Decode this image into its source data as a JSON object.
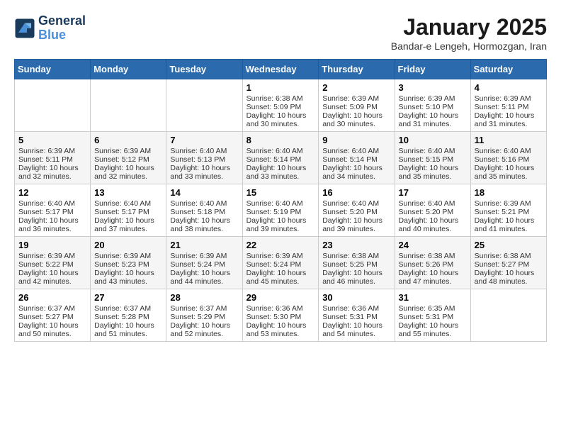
{
  "logo": {
    "line1": "General",
    "line2": "Blue"
  },
  "title": "January 2025",
  "subtitle": "Bandar-e Lengeh, Hormozgan, Iran",
  "days_of_week": [
    "Sunday",
    "Monday",
    "Tuesday",
    "Wednesday",
    "Thursday",
    "Friday",
    "Saturday"
  ],
  "weeks": [
    [
      {
        "day": "",
        "sunrise": "",
        "sunset": "",
        "daylight": ""
      },
      {
        "day": "",
        "sunrise": "",
        "sunset": "",
        "daylight": ""
      },
      {
        "day": "",
        "sunrise": "",
        "sunset": "",
        "daylight": ""
      },
      {
        "day": "1",
        "sunrise": "Sunrise: 6:38 AM",
        "sunset": "Sunset: 5:09 PM",
        "daylight": "Daylight: 10 hours and 30 minutes."
      },
      {
        "day": "2",
        "sunrise": "Sunrise: 6:39 AM",
        "sunset": "Sunset: 5:09 PM",
        "daylight": "Daylight: 10 hours and 30 minutes."
      },
      {
        "day": "3",
        "sunrise": "Sunrise: 6:39 AM",
        "sunset": "Sunset: 5:10 PM",
        "daylight": "Daylight: 10 hours and 31 minutes."
      },
      {
        "day": "4",
        "sunrise": "Sunrise: 6:39 AM",
        "sunset": "Sunset: 5:11 PM",
        "daylight": "Daylight: 10 hours and 31 minutes."
      }
    ],
    [
      {
        "day": "5",
        "sunrise": "Sunrise: 6:39 AM",
        "sunset": "Sunset: 5:11 PM",
        "daylight": "Daylight: 10 hours and 32 minutes."
      },
      {
        "day": "6",
        "sunrise": "Sunrise: 6:39 AM",
        "sunset": "Sunset: 5:12 PM",
        "daylight": "Daylight: 10 hours and 32 minutes."
      },
      {
        "day": "7",
        "sunrise": "Sunrise: 6:40 AM",
        "sunset": "Sunset: 5:13 PM",
        "daylight": "Daylight: 10 hours and 33 minutes."
      },
      {
        "day": "8",
        "sunrise": "Sunrise: 6:40 AM",
        "sunset": "Sunset: 5:14 PM",
        "daylight": "Daylight: 10 hours and 33 minutes."
      },
      {
        "day": "9",
        "sunrise": "Sunrise: 6:40 AM",
        "sunset": "Sunset: 5:14 PM",
        "daylight": "Daylight: 10 hours and 34 minutes."
      },
      {
        "day": "10",
        "sunrise": "Sunrise: 6:40 AM",
        "sunset": "Sunset: 5:15 PM",
        "daylight": "Daylight: 10 hours and 35 minutes."
      },
      {
        "day": "11",
        "sunrise": "Sunrise: 6:40 AM",
        "sunset": "Sunset: 5:16 PM",
        "daylight": "Daylight: 10 hours and 35 minutes."
      }
    ],
    [
      {
        "day": "12",
        "sunrise": "Sunrise: 6:40 AM",
        "sunset": "Sunset: 5:17 PM",
        "daylight": "Daylight: 10 hours and 36 minutes."
      },
      {
        "day": "13",
        "sunrise": "Sunrise: 6:40 AM",
        "sunset": "Sunset: 5:17 PM",
        "daylight": "Daylight: 10 hours and 37 minutes."
      },
      {
        "day": "14",
        "sunrise": "Sunrise: 6:40 AM",
        "sunset": "Sunset: 5:18 PM",
        "daylight": "Daylight: 10 hours and 38 minutes."
      },
      {
        "day": "15",
        "sunrise": "Sunrise: 6:40 AM",
        "sunset": "Sunset: 5:19 PM",
        "daylight": "Daylight: 10 hours and 39 minutes."
      },
      {
        "day": "16",
        "sunrise": "Sunrise: 6:40 AM",
        "sunset": "Sunset: 5:20 PM",
        "daylight": "Daylight: 10 hours and 39 minutes."
      },
      {
        "day": "17",
        "sunrise": "Sunrise: 6:40 AM",
        "sunset": "Sunset: 5:20 PM",
        "daylight": "Daylight: 10 hours and 40 minutes."
      },
      {
        "day": "18",
        "sunrise": "Sunrise: 6:39 AM",
        "sunset": "Sunset: 5:21 PM",
        "daylight": "Daylight: 10 hours and 41 minutes."
      }
    ],
    [
      {
        "day": "19",
        "sunrise": "Sunrise: 6:39 AM",
        "sunset": "Sunset: 5:22 PM",
        "daylight": "Daylight: 10 hours and 42 minutes."
      },
      {
        "day": "20",
        "sunrise": "Sunrise: 6:39 AM",
        "sunset": "Sunset: 5:23 PM",
        "daylight": "Daylight: 10 hours and 43 minutes."
      },
      {
        "day": "21",
        "sunrise": "Sunrise: 6:39 AM",
        "sunset": "Sunset: 5:24 PM",
        "daylight": "Daylight: 10 hours and 44 minutes."
      },
      {
        "day": "22",
        "sunrise": "Sunrise: 6:39 AM",
        "sunset": "Sunset: 5:24 PM",
        "daylight": "Daylight: 10 hours and 45 minutes."
      },
      {
        "day": "23",
        "sunrise": "Sunrise: 6:38 AM",
        "sunset": "Sunset: 5:25 PM",
        "daylight": "Daylight: 10 hours and 46 minutes."
      },
      {
        "day": "24",
        "sunrise": "Sunrise: 6:38 AM",
        "sunset": "Sunset: 5:26 PM",
        "daylight": "Daylight: 10 hours and 47 minutes."
      },
      {
        "day": "25",
        "sunrise": "Sunrise: 6:38 AM",
        "sunset": "Sunset: 5:27 PM",
        "daylight": "Daylight: 10 hours and 48 minutes."
      }
    ],
    [
      {
        "day": "26",
        "sunrise": "Sunrise: 6:37 AM",
        "sunset": "Sunset: 5:27 PM",
        "daylight": "Daylight: 10 hours and 50 minutes."
      },
      {
        "day": "27",
        "sunrise": "Sunrise: 6:37 AM",
        "sunset": "Sunset: 5:28 PM",
        "daylight": "Daylight: 10 hours and 51 minutes."
      },
      {
        "day": "28",
        "sunrise": "Sunrise: 6:37 AM",
        "sunset": "Sunset: 5:29 PM",
        "daylight": "Daylight: 10 hours and 52 minutes."
      },
      {
        "day": "29",
        "sunrise": "Sunrise: 6:36 AM",
        "sunset": "Sunset: 5:30 PM",
        "daylight": "Daylight: 10 hours and 53 minutes."
      },
      {
        "day": "30",
        "sunrise": "Sunrise: 6:36 AM",
        "sunset": "Sunset: 5:31 PM",
        "daylight": "Daylight: 10 hours and 54 minutes."
      },
      {
        "day": "31",
        "sunrise": "Sunrise: 6:35 AM",
        "sunset": "Sunset: 5:31 PM",
        "daylight": "Daylight: 10 hours and 55 minutes."
      },
      {
        "day": "",
        "sunrise": "",
        "sunset": "",
        "daylight": ""
      }
    ]
  ]
}
